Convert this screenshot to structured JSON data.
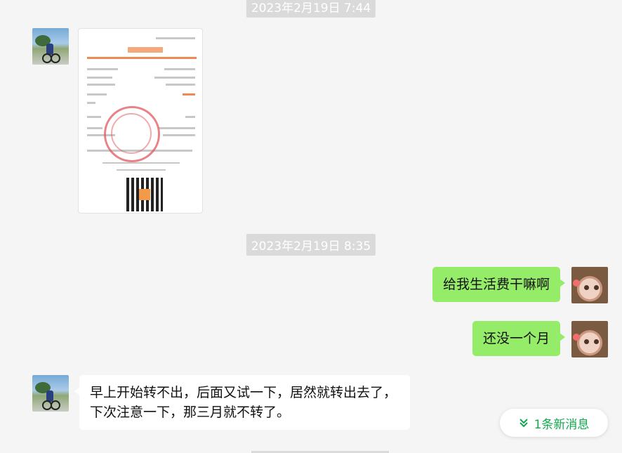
{
  "timestamps": [
    "2023年2月19日 7:44",
    "2023年2月19日 8:35"
  ],
  "messages": {
    "m1": "给我生活费干嘛啊",
    "m2": "还没一个月",
    "m3": "早上开始转不出，后面又试一下，居然就转出去了，下次注意一下，那三月就不转了。"
  },
  "new_messages": {
    "label": "1条新消息",
    "icon": "chevron-double-down-icon"
  },
  "colors": {
    "self_bubble": "#95ec69",
    "other_bubble": "#ffffff",
    "accent": "#13a84e",
    "background": "#f5f5f5"
  }
}
